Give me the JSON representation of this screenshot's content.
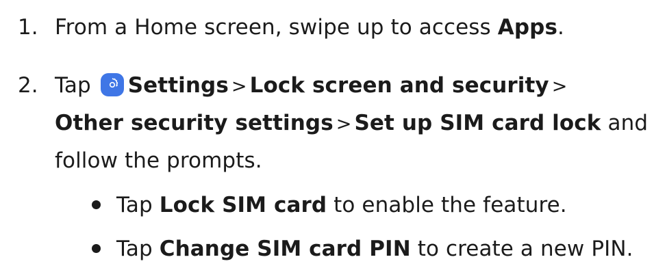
{
  "steps": [
    {
      "number": "1.",
      "text_before": "From a Home screen, swipe up to access ",
      "bold": "Apps",
      "text_after": "."
    },
    {
      "number": "2.",
      "tap": "Tap",
      "settings": "Settings",
      "separator": ">",
      "lock_screen": "Lock screen and security",
      "other_security": "Other security settings",
      "sim_lock": "Set up SIM card lock",
      "and": "and",
      "follow": "follow the prompts."
    }
  ],
  "bullets": [
    {
      "tap": "Tap",
      "bold": "Lock SIM card",
      "rest": "to enable the feature."
    },
    {
      "tap": "Tap",
      "bold": "Change SIM card PIN",
      "rest": "to create a new PIN."
    }
  ],
  "icons": {
    "settings": "settings-gear-icon"
  },
  "colors": {
    "text": "#1b1b1b",
    "settings_icon": "#3f76e6"
  }
}
